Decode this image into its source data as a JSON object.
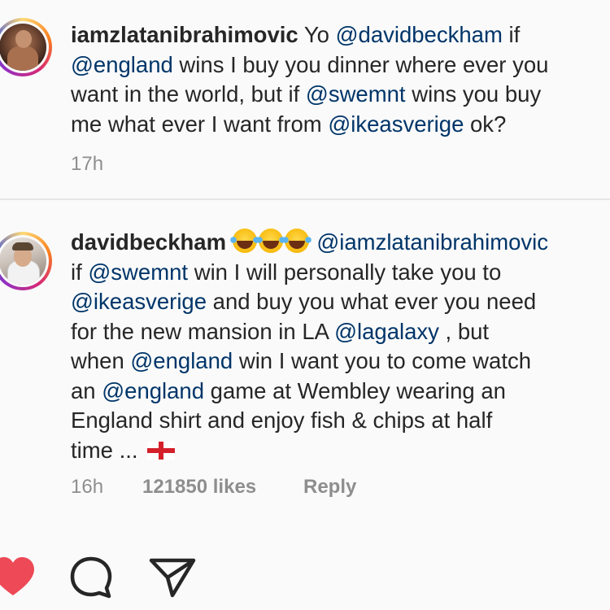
{
  "comments": [
    {
      "username": "iamzlatanibrahimovic",
      "lines": [
        [
          {
            "t": "Yo "
          },
          {
            "m": "@davidbeckham"
          },
          {
            "t": " if"
          }
        ],
        [
          {
            "m": "@england"
          },
          {
            "t": " wins I buy you dinner where ever you"
          }
        ],
        [
          {
            "t": "want in the world, but if "
          },
          {
            "m": "@swemnt"
          },
          {
            "t": " wins you buy"
          }
        ],
        [
          {
            "t": "me what ever I want from "
          },
          {
            "m": "@ikeasverige"
          },
          {
            "t": " ok?"
          }
        ]
      ],
      "time": "17h"
    },
    {
      "username": "davidbeckham",
      "lines": [
        [
          {
            "e": "joy"
          },
          {
            "e": "joy"
          },
          {
            "e": "joy"
          },
          {
            "t": " "
          },
          {
            "m": "@iamzlatanibrahimovic"
          }
        ],
        [
          {
            "t": "if "
          },
          {
            "m": "@swemnt"
          },
          {
            "t": " win I will personally take you to"
          }
        ],
        [
          {
            "m": "@ikeasverige"
          },
          {
            "t": " and buy you what ever you need"
          }
        ],
        [
          {
            "t": "for the new mansion in LA "
          },
          {
            "m": "@lagalaxy"
          },
          {
            "t": " , but"
          }
        ],
        [
          {
            "t": "when "
          },
          {
            "m": "@england"
          },
          {
            "t": " win I want you to come watch"
          }
        ],
        [
          {
            "t": "an "
          },
          {
            "m": "@england"
          },
          {
            "t": " game at Wembley wearing an"
          }
        ],
        [
          {
            "t": "England shirt and enjoy fish & chips at half"
          }
        ],
        [
          {
            "t": "time ... "
          },
          {
            "e": "england-flag"
          }
        ]
      ],
      "time": "16h",
      "likes": "121850 likes",
      "reply": "Reply"
    }
  ],
  "actions": {
    "like_icon": "heart-icon",
    "comment_icon": "comment-icon",
    "share_icon": "send-icon",
    "like_color": "#ed4956"
  },
  "colors": {
    "mention": "#003569",
    "meta": "#8e8e8e",
    "text": "#262626"
  }
}
